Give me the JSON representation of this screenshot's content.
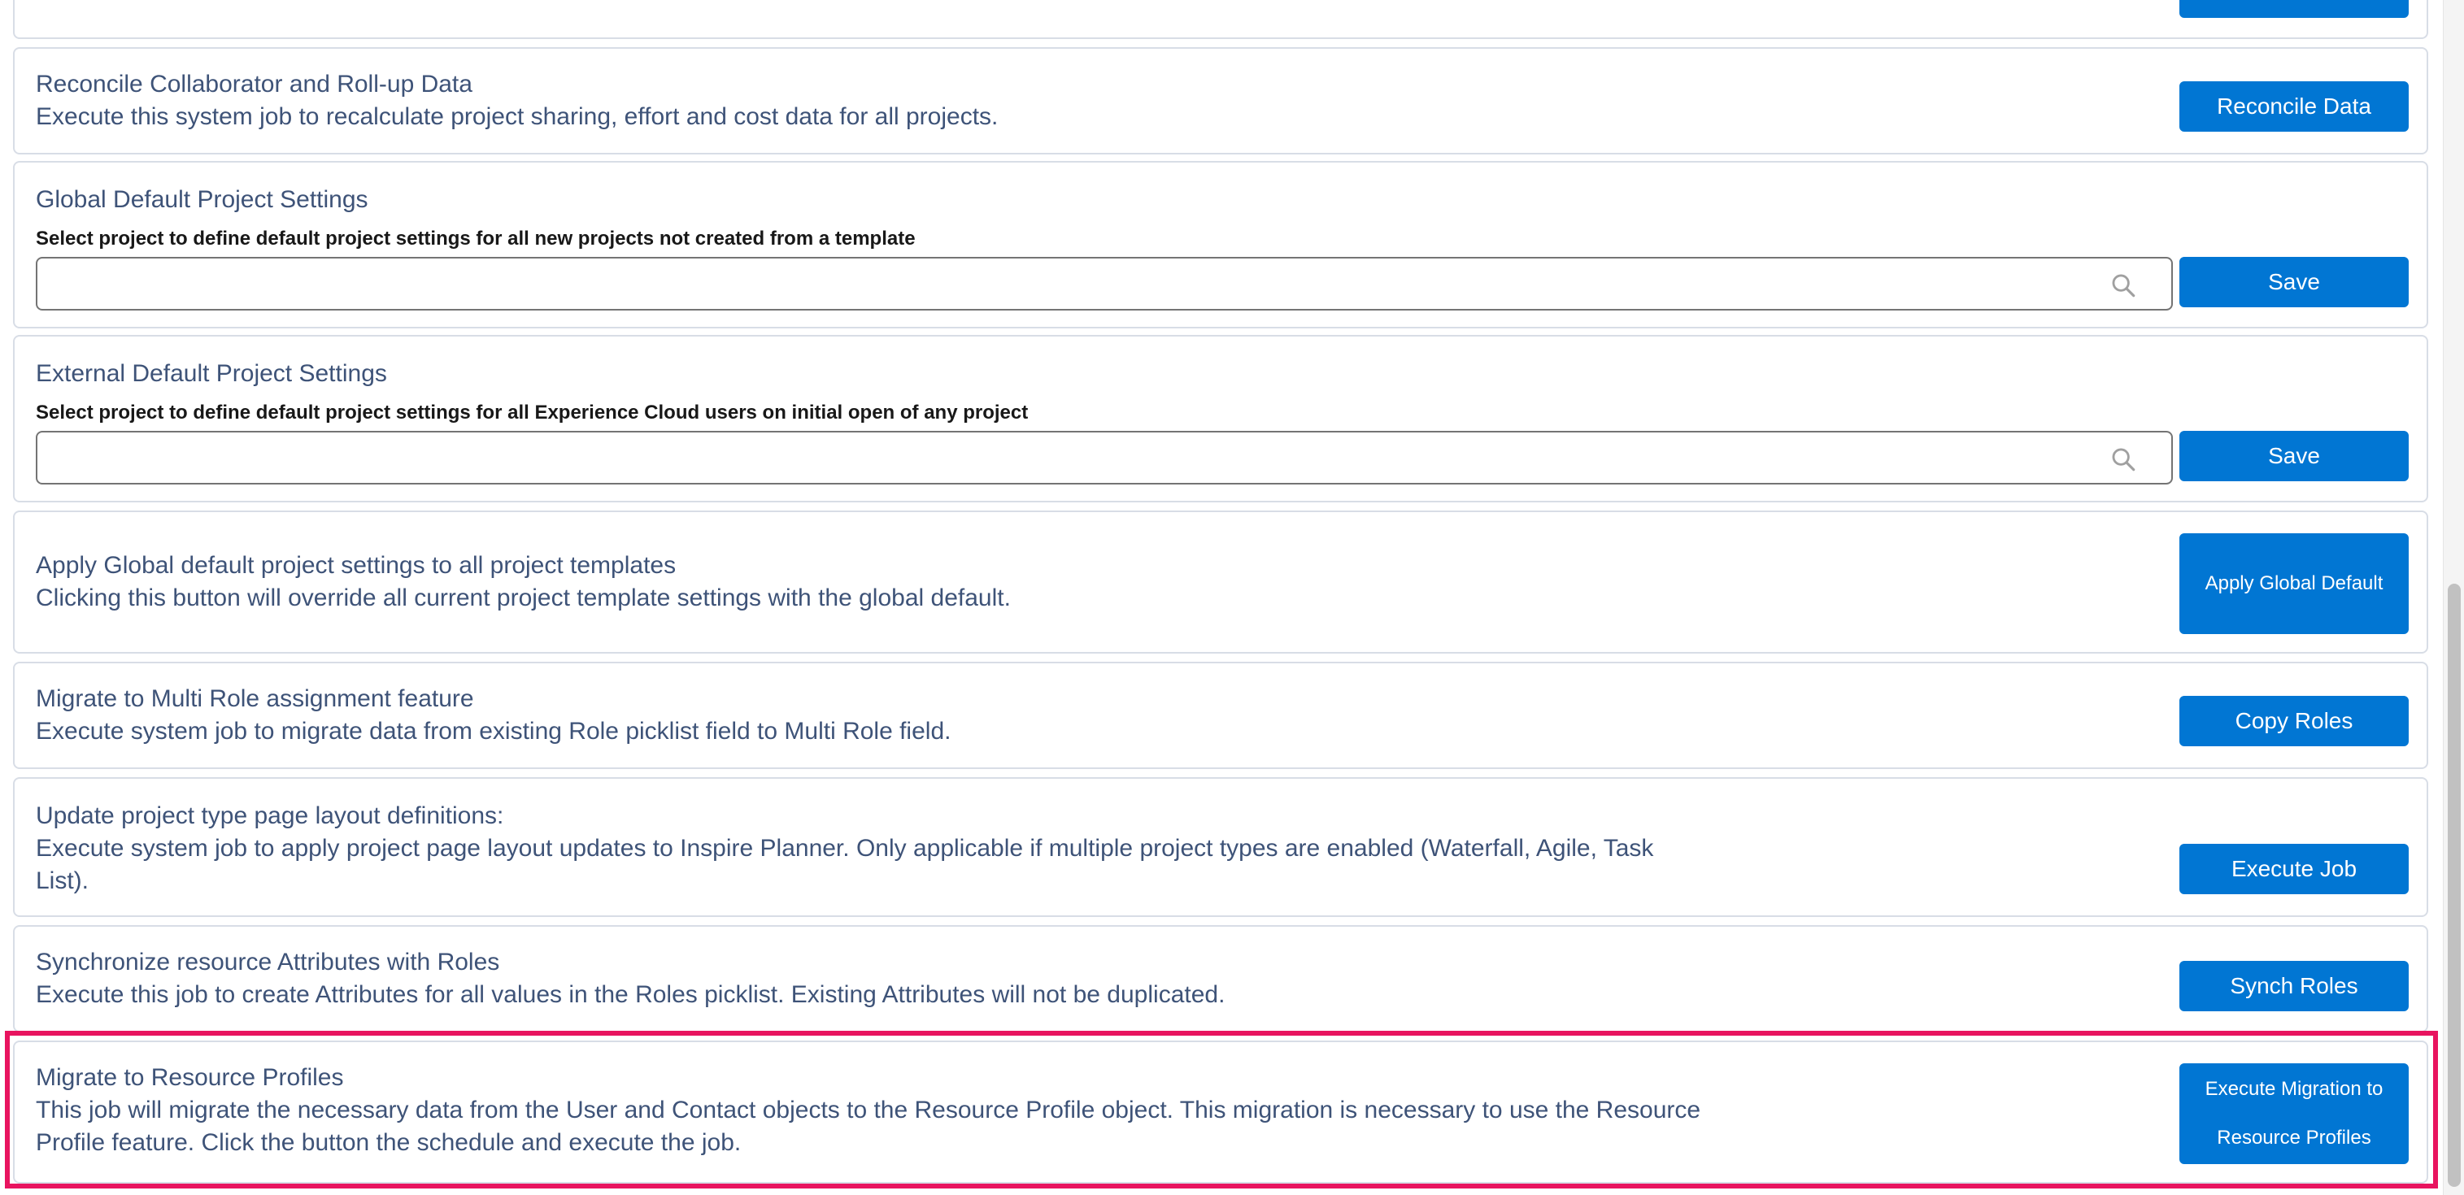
{
  "sections": {
    "partial_top": {
      "button_label": ""
    },
    "reconcile": {
      "title": "Reconcile Collaborator and Roll-up Data",
      "description": "Execute this system job to recalculate project sharing, effort and cost data for all projects.",
      "button_label": "Reconcile Data"
    },
    "global_default": {
      "title": "Global Default Project Settings",
      "field_label": "Select project to define default project settings for all new projects not created from a template",
      "input_value": "",
      "button_label": "Save"
    },
    "external_default": {
      "title": "External Default Project Settings",
      "field_label": "Select project to define default project settings for all Experience Cloud users on initial open of any project",
      "input_value": "",
      "button_label": "Save"
    },
    "apply_global": {
      "title": "Apply Global default project settings to all project templates",
      "description": "Clicking this button will override all current project template settings with the global default.",
      "button_label": "Apply Global Default"
    },
    "multi_role": {
      "title": "Migrate to Multi Role assignment feature",
      "description": "Execute system job to migrate data from existing Role picklist field to Multi Role field.",
      "button_label": "Copy Roles"
    },
    "page_layout": {
      "title": "Update project type page layout definitions:",
      "description": "Execute system job to apply project page layout updates to Inspire Planner. Only applicable if multiple project types are enabled (Waterfall, Agile, Task List).",
      "button_label": "Execute Job"
    },
    "synch_roles": {
      "title": "Synchronize resource Attributes with Roles",
      "description": "Execute this job to create Attributes for all values in the Roles picklist. Existing Attributes will not be duplicated.",
      "button_label": "Synch Roles"
    },
    "resource_profiles": {
      "title": "Migrate to Resource Profiles",
      "description": "This job will migrate the necessary data from the User and Contact objects to the Resource Profile object. This migration is necessary to use the Resource Profile feature. Click the button the schedule and execute the job.",
      "button_label": "Execute Migration to Resource Profiles"
    }
  },
  "colors": {
    "brand_button": "#0176d3",
    "text": "#3e5378",
    "highlight": "#e8145f",
    "border": "#d8dde6"
  },
  "icons": {
    "lookup": "search-icon"
  }
}
